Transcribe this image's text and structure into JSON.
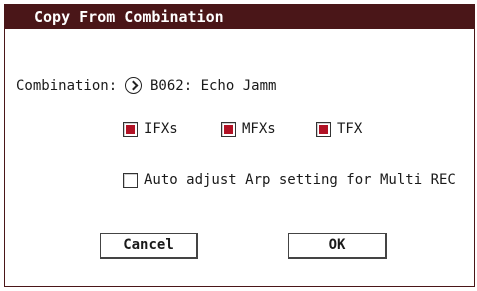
{
  "dialog": {
    "title": "Copy From Combination"
  },
  "combination": {
    "label": "Combination:",
    "value": "B062: Echo Jamm",
    "selector_icon": "chevron-right-circle-icon"
  },
  "options": {
    "ifxs": {
      "label": "IFXs",
      "checked": true
    },
    "mfxs": {
      "label": "MFXs",
      "checked": true
    },
    "tfx": {
      "label": "TFX",
      "checked": true
    },
    "auto_adjust": {
      "label": "Auto adjust Arp setting for Multi REC",
      "checked": false
    }
  },
  "buttons": {
    "cancel": "Cancel",
    "ok": "OK"
  },
  "colors": {
    "titlebar": "#4a1618",
    "check_fill": "#b11225"
  }
}
